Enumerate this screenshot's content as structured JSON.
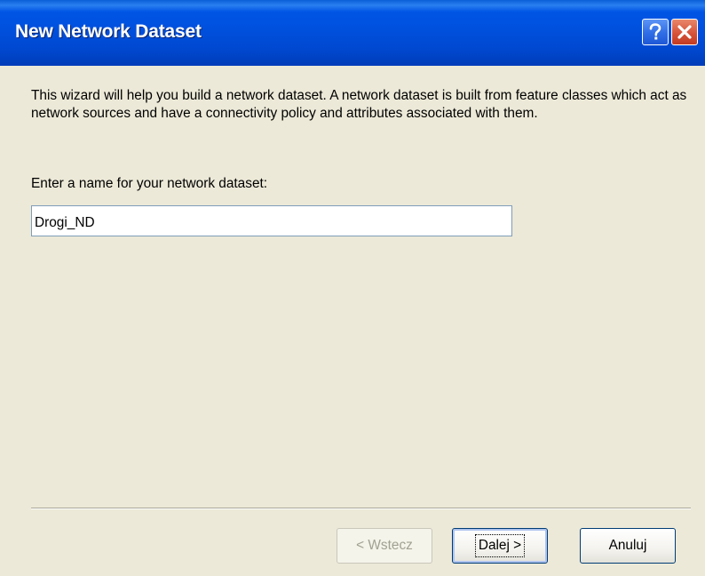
{
  "window": {
    "title": "New Network Dataset",
    "help_icon": "help-icon",
    "close_icon": "close-icon"
  },
  "wizard": {
    "intro_text": "This wizard will help you build a network dataset.  A network dataset is built from feature classes which act as network sources and have a connectivity policy and attributes associated with them.",
    "name_label": "Enter a name for your network dataset:",
    "name_value": "Drogi_ND"
  },
  "buttons": {
    "back_label": "< Wstecz",
    "back_enabled": false,
    "next_label": "Dalej >",
    "next_default": true,
    "cancel_label": "Anuluj"
  },
  "colors": {
    "titlebar_blue": "#0054e3",
    "dialog_face": "#ece9d8",
    "close_button_red": "#d6533a",
    "help_button_blue": "#2f6de6",
    "disabled_text": "#a1a192"
  }
}
